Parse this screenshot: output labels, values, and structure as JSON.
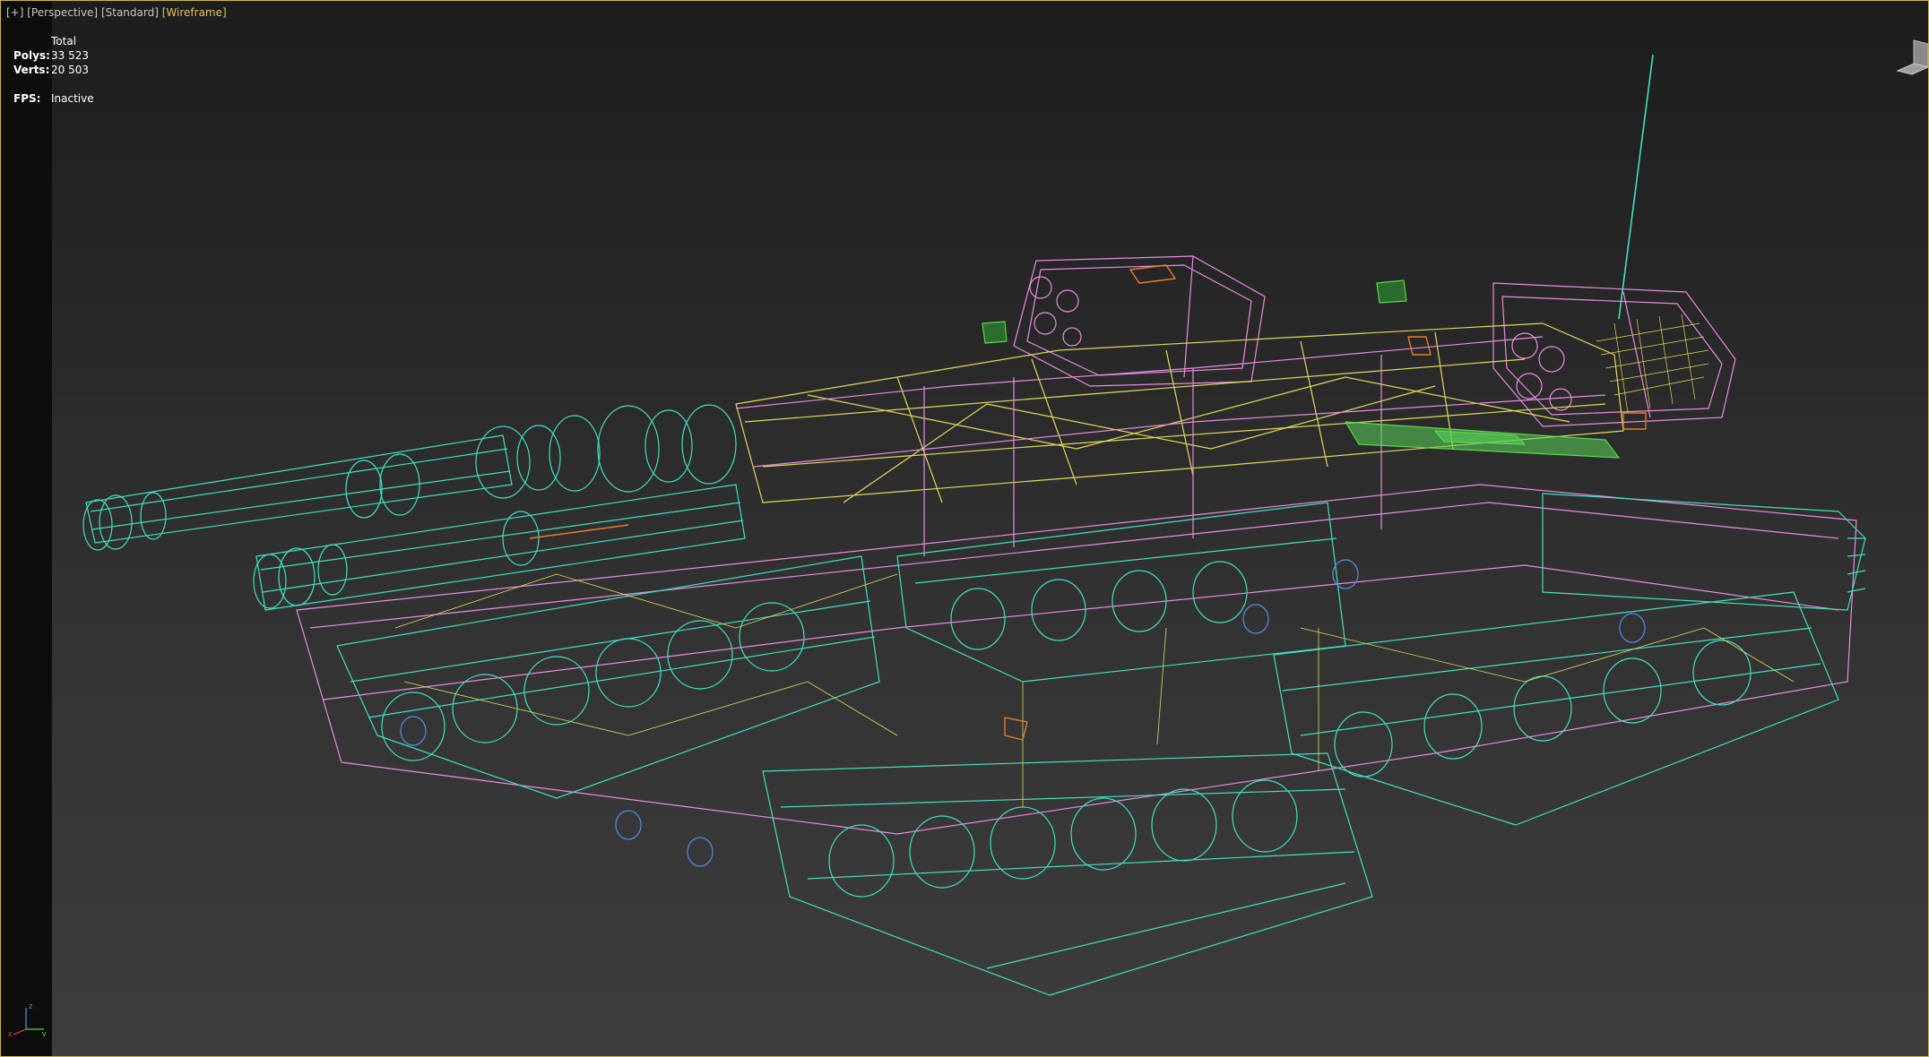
{
  "viewport": {
    "labels": [
      {
        "text": "[+]",
        "state": "normal"
      },
      {
        "text": "[Perspective]",
        "state": "normal"
      },
      {
        "text": "[Standard]",
        "state": "normal"
      },
      {
        "text": "[Wireframe]",
        "state": "active"
      }
    ],
    "colors": {
      "border": "#c8b448",
      "active_label": "#e6c25a",
      "wire_cyan": "#3fe0c0",
      "wire_pink": "#e98be0",
      "wire_yellow": "#e0d95a",
      "wire_orange": "#e87c2a",
      "wire_green": "#58d94a",
      "wire_blue": "#4f8fe0"
    }
  },
  "stats": {
    "header": "Total",
    "polys_label": "Polys:",
    "polys_value": "33 523",
    "verts_label": "Verts:",
    "verts_value": "20 503",
    "fps_label": "FPS:",
    "fps_value": "Inactive"
  },
  "axis": {
    "z": "z",
    "x": "x",
    "y": "y"
  },
  "icons": {
    "viewcube": "viewcube-icon",
    "axis": "axis-tripod-icon"
  }
}
